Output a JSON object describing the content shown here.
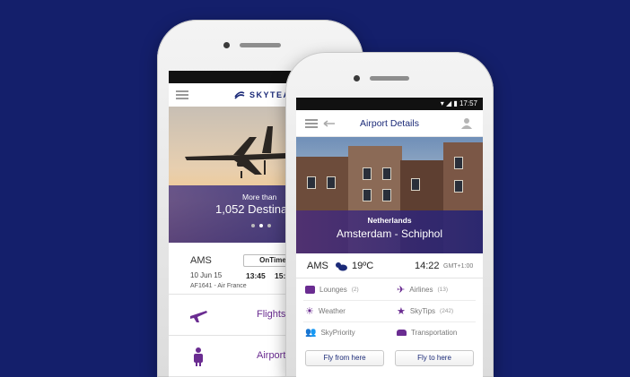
{
  "colors": {
    "background": "#141f6b",
    "brand": "#1b2a78",
    "accent": "#6a2c91"
  },
  "phone1": {
    "logo_text": "SKYTEAM",
    "hero": {
      "line1": "More than",
      "line2": "1,052 Destinati"
    },
    "flight": {
      "code": "AMS",
      "status": "OnTime",
      "date": "10 Jun 15",
      "dep": "13:45",
      "arr": "15:00",
      "number": "AF1641 - Air France"
    },
    "menu": [
      {
        "label": "Flights",
        "icon": "airplane-icon"
      },
      {
        "label": "Airports",
        "icon": "traveler-icon"
      }
    ]
  },
  "phone2": {
    "status_time": "17:57",
    "title": "Airport Details",
    "country": "Netherlands",
    "airport": "Amsterdam - Schiphol",
    "weather": {
      "code": "AMS",
      "temp": "19ºC",
      "time": "14:22",
      "gmt": "GMT+1:00"
    },
    "items": [
      {
        "label": "Lounges",
        "count": "(2)",
        "icon": "lounge-icon"
      },
      {
        "label": "Airlines",
        "count": "(13)",
        "icon": "airplane-icon"
      },
      {
        "label": "Weather",
        "count": "",
        "icon": "sun-icon"
      },
      {
        "label": "SkyTips",
        "count": "(242)",
        "icon": "star-icon"
      },
      {
        "label": "SkyPriority",
        "count": "",
        "icon": "people-icon"
      },
      {
        "label": "Transportation",
        "count": "",
        "icon": "car-icon"
      }
    ],
    "buttons": {
      "fly_from": "Fly from here",
      "fly_to": "Fly to here"
    }
  }
}
